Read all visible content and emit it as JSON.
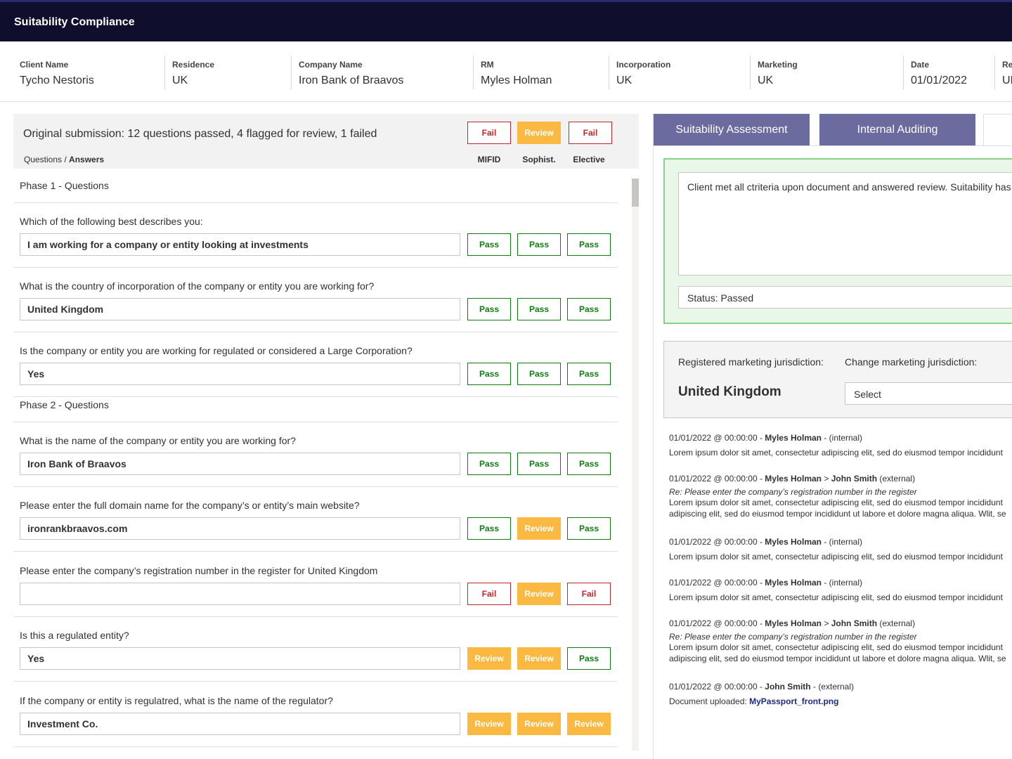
{
  "app": {
    "title": "Suitability Compliance"
  },
  "info": [
    {
      "label": "Client Name",
      "value": "Tycho Nestoris"
    },
    {
      "label": "Residence",
      "value": "UK"
    },
    {
      "label": "Company Name",
      "value": "Iron Bank of Braavos"
    },
    {
      "label": "RM",
      "value": "Myles Holman"
    },
    {
      "label": "Incorporation",
      "value": "UK"
    },
    {
      "label": "Marketing",
      "value": "UK"
    },
    {
      "label": "Date",
      "value": "01/01/2022"
    },
    {
      "label": "Re",
      "value": "UI"
    }
  ],
  "summary": {
    "text": "Original submission: 12 questions passed, 4 flagged for review, 1 failed",
    "questions_label": "Questions",
    "slash": " / ",
    "answers_label": "Answers",
    "totals": [
      "Fail",
      "Review",
      "Fail"
    ],
    "columns": [
      "MIFID",
      "Sophist.",
      "Elective"
    ]
  },
  "phases": [
    {
      "title": "Phase 1 - Questions"
    },
    {
      "title": "Phase 2 - Questions"
    }
  ],
  "questions": [
    {
      "q": "Which of the following best describes you:",
      "a": "I am working for a company or entity looking at investments",
      "results": [
        "Pass",
        "Pass",
        "Pass"
      ]
    },
    {
      "q": "What is the country of incorporation of the company or entity you are working for?",
      "a": "United Kingdom",
      "results": [
        "Pass",
        "Pass",
        "Pass"
      ]
    },
    {
      "q": "Is the company or entity you are working for regulated or considered a Large Corporation?",
      "a": "Yes",
      "results": [
        "Pass",
        "Pass",
        "Pass"
      ]
    },
    {
      "q": "What is the name of the company or entity you are working for?",
      "a": "Iron Bank of Braavos",
      "results": [
        "Pass",
        "Pass",
        "Pass"
      ]
    },
    {
      "q": "Please enter the full domain name for the company’s or entity’s main website?",
      "a": "ironrankbraavos.com",
      "results": [
        "Pass",
        "Review",
        "Pass"
      ]
    },
    {
      "q": "Please enter the company’s registration number in the register for United Kingdom",
      "a": "",
      "results": [
        "Fail",
        "Review",
        "Fail"
      ]
    },
    {
      "q": "Is this a regulated entity?",
      "a": "Yes",
      "results": [
        "Review",
        "Review",
        "Pass"
      ]
    },
    {
      "q": "If the company or entity is regulatred, what is the name of the regulator?",
      "a": "Investment Co.",
      "results": [
        "Review",
        "Review",
        "Review"
      ]
    }
  ],
  "tabs": [
    "Suitability Assessment",
    "Internal Auditing",
    ""
  ],
  "assessment": {
    "comment": "Client met all ctriteria upon document and answered review. Suitability has",
    "status": "Status: Passed"
  },
  "jurisdiction": {
    "registered_label": "Registered marketing jurisdiction:",
    "registered_value": "United Kingdom",
    "change_label": "Change marketing jurisdiction:",
    "select_value": "Select"
  },
  "log": [
    {
      "date": "01/01/2022 @ 00:00:00",
      "author": "Myles Holman",
      "arrow": "",
      "to": "",
      "type": "(internal)",
      "re": "",
      "body": [
        "Lorem ipsum dolor sit amet, consectetur adipiscing elit, sed do eiusmod tempor incididunt"
      ]
    },
    {
      "date": "01/01/2022 @ 00:00:00",
      "author": "Myles Holman",
      "arrow": ">",
      "to": "John Smith",
      "type": "(external)",
      "re": "Re: Please enter the company’s registration number in the register",
      "body": [
        "Lorem ipsum dolor sit amet, consectetur adipiscing elit, sed do eiusmod tempor incididunt",
        "adipiscing elit, sed do eiusmod tempor incididunt ut labore et dolore magna aliqua. Wlit, se"
      ]
    },
    {
      "date": "01/01/2022 @ 00:00:00",
      "author": "Myles Holman",
      "arrow": "",
      "to": "",
      "type": "(internal)",
      "re": "",
      "body": [
        "Lorem ipsum dolor sit amet, consectetur adipiscing elit, sed do eiusmod tempor incididunt"
      ]
    },
    {
      "date": "01/01/2022 @ 00:00:00",
      "author": "Myles Holman",
      "arrow": "",
      "to": "",
      "type": "(internal)",
      "re": "",
      "body": [
        "Lorem ipsum dolor sit amet, consectetur adipiscing elit, sed do eiusmod tempor incididunt"
      ]
    },
    {
      "date": "01/01/2022 @ 00:00:00",
      "author": "Myles Holman",
      "arrow": ">",
      "to": "John Smith",
      "type": "(external)",
      "re": "Re: Please enter the company’s registration number in the register",
      "body": [
        "Lorem ipsum dolor sit amet, consectetur adipiscing elit, sed do eiusmod tempor incididunt",
        "adipiscing elit, sed do eiusmod tempor incididunt ut labore et dolore magna aliqua. Wlit, se"
      ]
    },
    {
      "date": "01/01/2022 @ 00:00:00",
      "author": "John Smith",
      "arrow": "",
      "to": "",
      "type": "(external)",
      "re": "",
      "upload_label": "Document uploaded:",
      "upload_file": "MyPassport_front.png",
      "body": []
    }
  ]
}
